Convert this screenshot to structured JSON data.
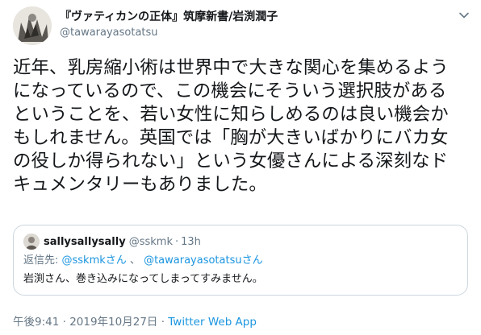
{
  "author": {
    "display_name": "『ヴァティカンの正体』筑摩新書/岩渕潤子",
    "handle": "@tawarayasotatsu"
  },
  "tweet": {
    "lines": [
      "近年、乳房縮小術は世界中で大きな関心を集めるよう",
      "になっているので、この機会にそういう選択肢がある",
      "ということを、若い女性に知らしめるのは良い機会か",
      "もしれません。英国では「胸が大きいばかりにバカ女",
      "の役しか得られない」という女優さんによる深刻なド",
      "キュメンタリーもありました。"
    ]
  },
  "quoted": {
    "name": "sallysallysally",
    "handle": "@sskmk",
    "separator": "·",
    "time": "13h",
    "reply_prefix": "返信先: ",
    "reply_to_1": "@sskmkさん",
    "reply_mid": " 、 ",
    "reply_to_2": "@tawarayasotatsuさん",
    "text": "岩渕さん、巻き込みになってしまってすみません。"
  },
  "meta": {
    "time": "午後9:41",
    "separator": " · ",
    "date": "2019年10月27日",
    "separator2": " · ",
    "source": "Twitter Web App"
  },
  "icons": {
    "caret": "chevron-down-icon",
    "avatar": "user-avatar",
    "quoted_avatar": "quoted-user-avatar"
  },
  "colors": {
    "link": "#1b95e0",
    "secondary_text": "#657786",
    "border": "#ccd6dd"
  }
}
